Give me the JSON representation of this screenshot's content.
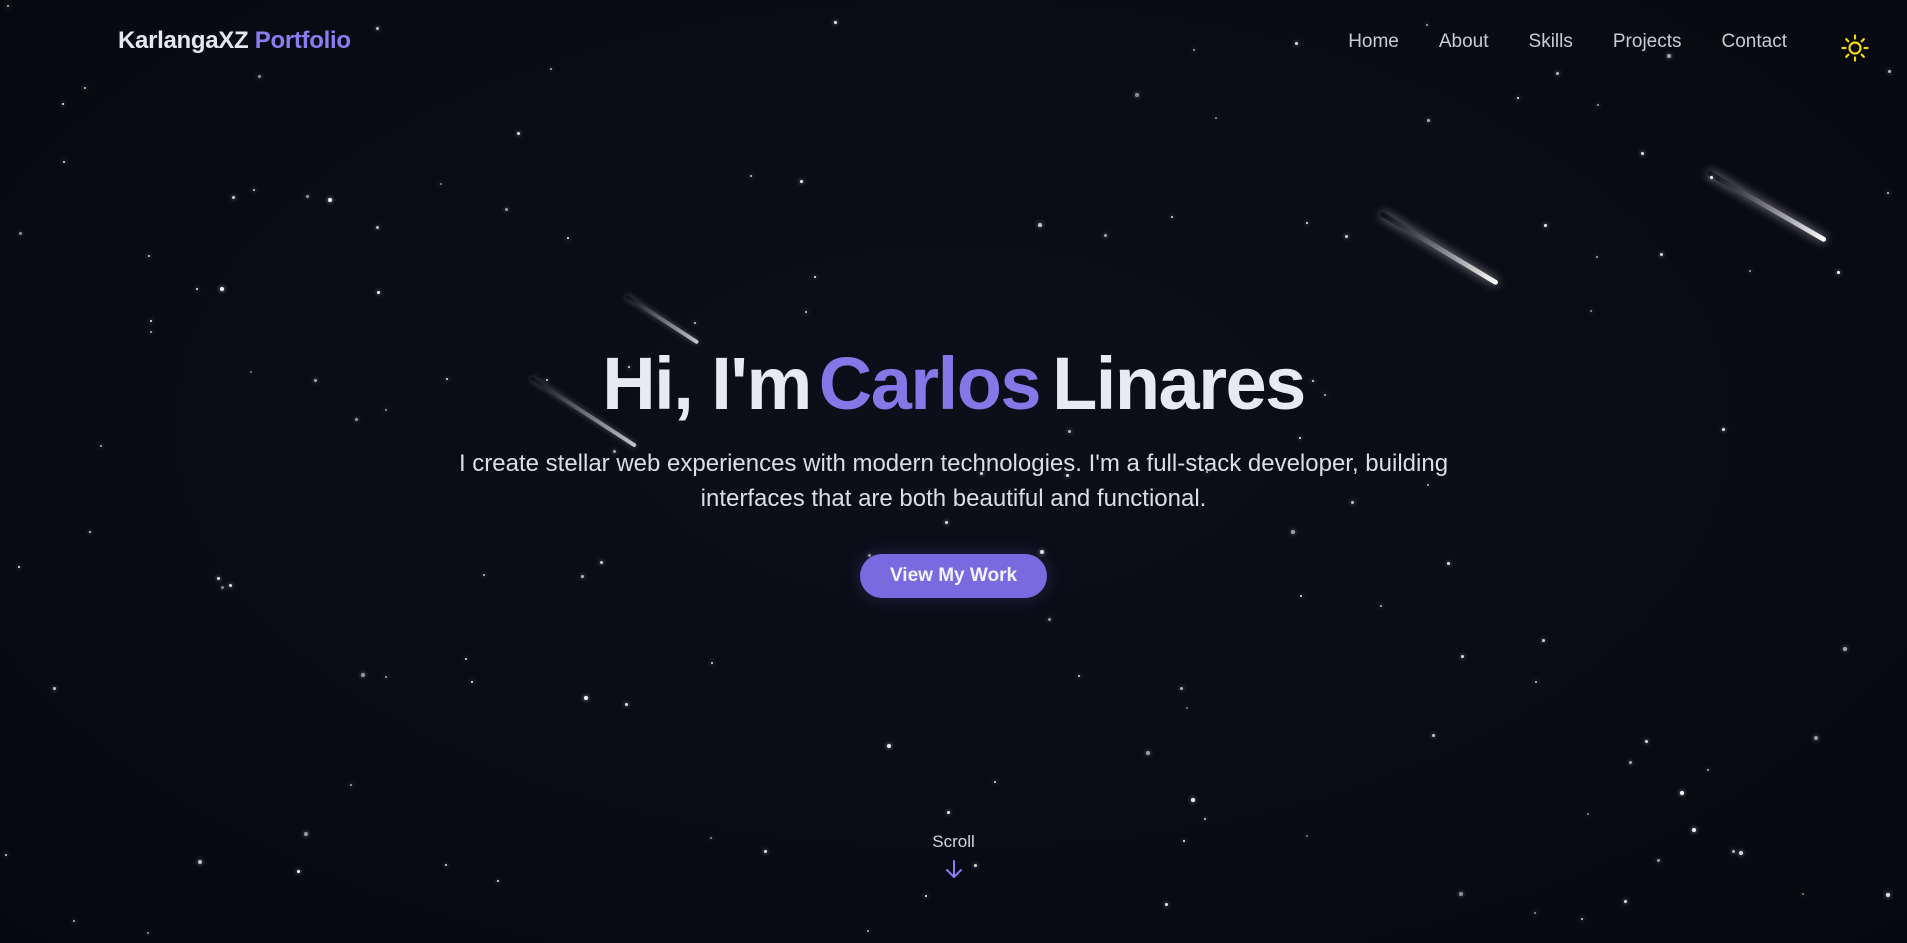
{
  "brand": {
    "name": "KarlangaXZ",
    "accent_word": "Portfolio"
  },
  "nav": {
    "items": [
      {
        "label": "Home"
      },
      {
        "label": "About"
      },
      {
        "label": "Skills"
      },
      {
        "label": "Projects"
      },
      {
        "label": "Contact"
      }
    ],
    "theme_toggle_icon": "sun-icon"
  },
  "hero": {
    "greeting": "Hi, I'm",
    "first_name": "Carlos",
    "last_name": "Linares",
    "subtitle": "I create stellar web experiences with modern technologies. I'm a full-stack developer, building interfaces that are both beautiful and functional.",
    "cta_label": "View My Work"
  },
  "scroll": {
    "label": "Scroll",
    "icon": "arrow-down-icon"
  },
  "colors": {
    "background": "#0a0b14",
    "accent": "#7a6ae0",
    "sun": "#f5d90a",
    "text": "#e8e9f5"
  }
}
